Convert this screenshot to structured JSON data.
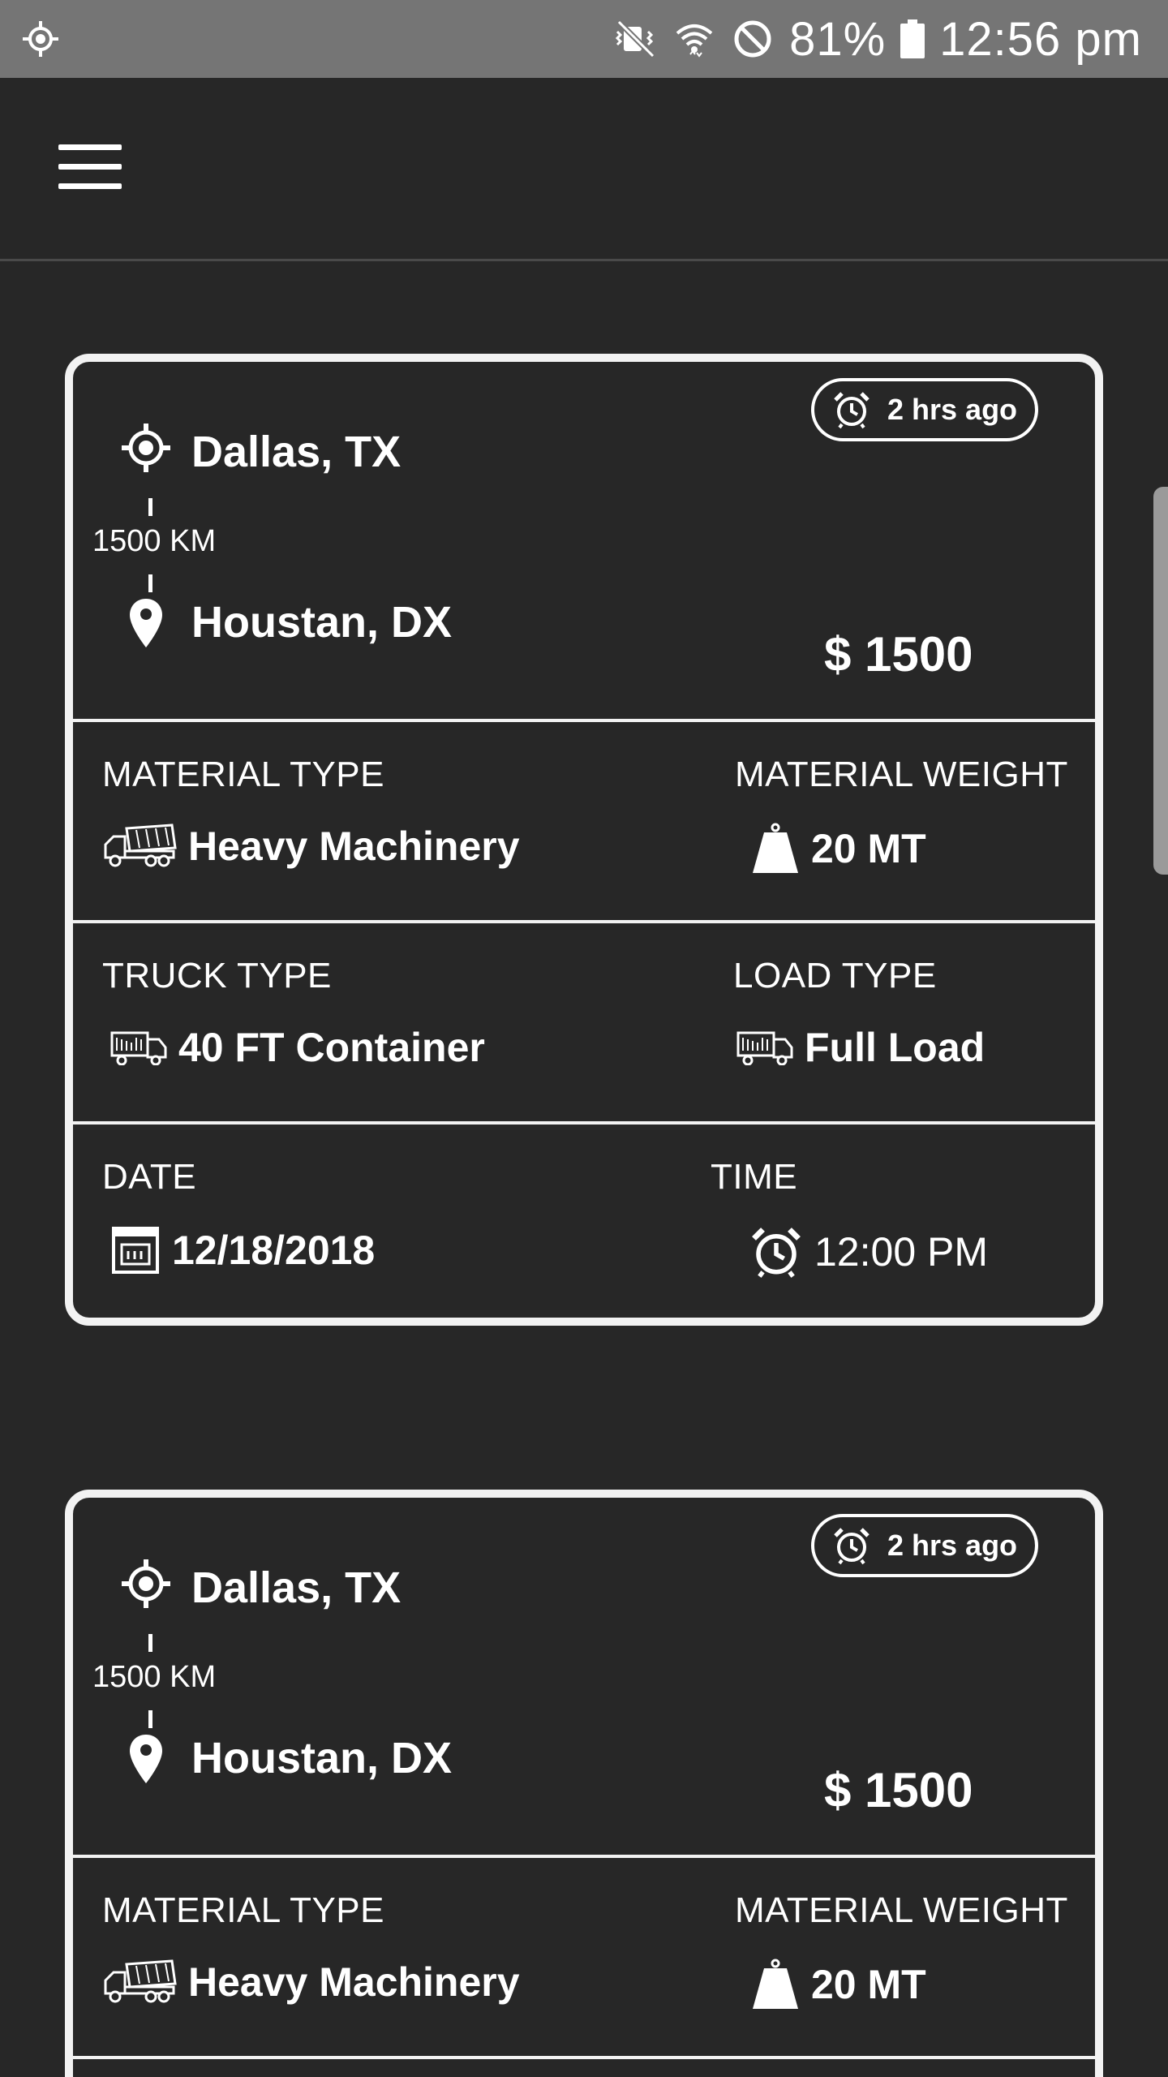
{
  "status_bar": {
    "battery_percent": "81%",
    "time": "12:56 pm",
    "icons": [
      "gps-icon",
      "vibrate-mute-icon",
      "wifi-icon",
      "do-not-disturb-icon",
      "battery-icon"
    ]
  },
  "app_bar": {
    "menu_icon": "hamburger-menu-icon"
  },
  "cards": [
    {
      "posted": "2 hrs ago",
      "origin": "Dallas, TX",
      "distance": "1500 KM",
      "destination": "Houstan, DX",
      "price": "$ 1500",
      "material_type_label": "MATERIAL TYPE",
      "material_type": "Heavy Machinery",
      "material_weight_label": "MATERIAL WEIGHT",
      "material_weight": "20 MT",
      "truck_type_label": "TRUCK TYPE",
      "truck_type": "40 FT Container",
      "load_type_label": "LOAD TYPE",
      "load_type": "Full Load",
      "date_label": "DATE",
      "date": "12/18/2018",
      "time_label": "TIME",
      "time": "12:00 PM"
    },
    {
      "posted": "2 hrs ago",
      "origin": "Dallas, TX",
      "distance": "1500 KM",
      "destination": "Houstan, DX",
      "price": "$ 1500",
      "material_type_label": "MATERIAL TYPE",
      "material_type": "Heavy Machinery",
      "material_weight_label": "MATERIAL WEIGHT",
      "material_weight": "20 MT"
    }
  ],
  "colors": {
    "background": "#272727",
    "status_bar": "#757575",
    "card_border": "#f2f2f2",
    "text": "#ffffff"
  }
}
